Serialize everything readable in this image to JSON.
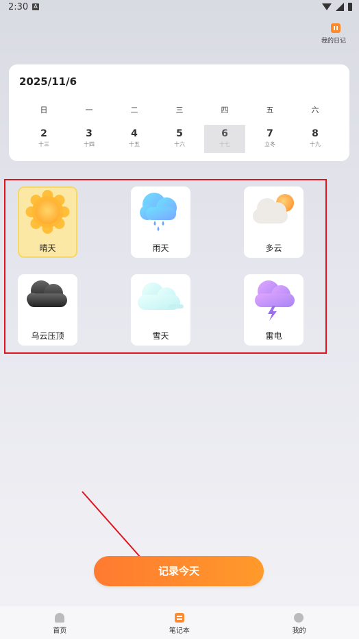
{
  "status_bar": {
    "time": "2:30",
    "notification": "A"
  },
  "header": {
    "diary_label": "我的日记"
  },
  "calendar": {
    "date": "2025/11/6",
    "weekdays": [
      "日",
      "一",
      "二",
      "三",
      "四",
      "五",
      "六"
    ],
    "days": [
      {
        "num": "2",
        "lunar": "十三"
      },
      {
        "num": "3",
        "lunar": "十四"
      },
      {
        "num": "4",
        "lunar": "十五"
      },
      {
        "num": "5",
        "lunar": "十六"
      },
      {
        "num": "6",
        "lunar": "十七"
      },
      {
        "num": "7",
        "lunar": "立冬"
      },
      {
        "num": "8",
        "lunar": "十九"
      }
    ],
    "selected_day": "6"
  },
  "weather": {
    "options": [
      {
        "label": "晴天",
        "icon": "sun-icon"
      },
      {
        "label": "雨天",
        "icon": "rain-cloud-icon"
      },
      {
        "label": "多云",
        "icon": "partly-cloudy-icon"
      },
      {
        "label": "乌云压顶",
        "icon": "dark-cloud-icon"
      },
      {
        "label": "雪天",
        "icon": "snow-cloud-icon"
      },
      {
        "label": "雷电",
        "icon": "thunder-cloud-icon"
      }
    ],
    "selected": "晴天"
  },
  "record_button": {
    "label": "记录今天"
  },
  "bottom_nav": {
    "items": [
      {
        "label": "首页",
        "icon": "home-icon"
      },
      {
        "label": "笔记本",
        "icon": "notebook-icon"
      },
      {
        "label": "我的",
        "icon": "profile-icon"
      }
    ],
    "active": "笔记本"
  },
  "colors": {
    "accent": "#ff8a2b",
    "annotation_red": "#e0141f",
    "selected_tile": "#fbe8a5"
  }
}
